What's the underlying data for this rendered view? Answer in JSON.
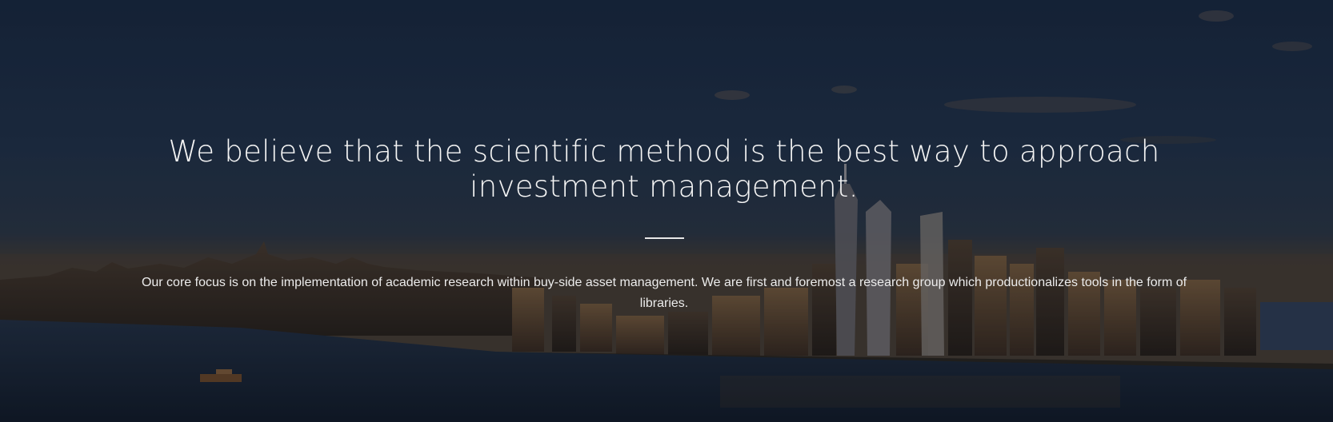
{
  "hero": {
    "headline": "We believe that the scientific method is the best way to approach investment management.",
    "subtext": "Our core focus is on the implementation of academic research within buy-side asset management. We are first and foremost a research group which productionalizes tools in the form of libraries."
  },
  "background": {
    "description_icon": "city-skyline-image",
    "sky_color": "#1e2f47",
    "water_color": "#18253a"
  }
}
